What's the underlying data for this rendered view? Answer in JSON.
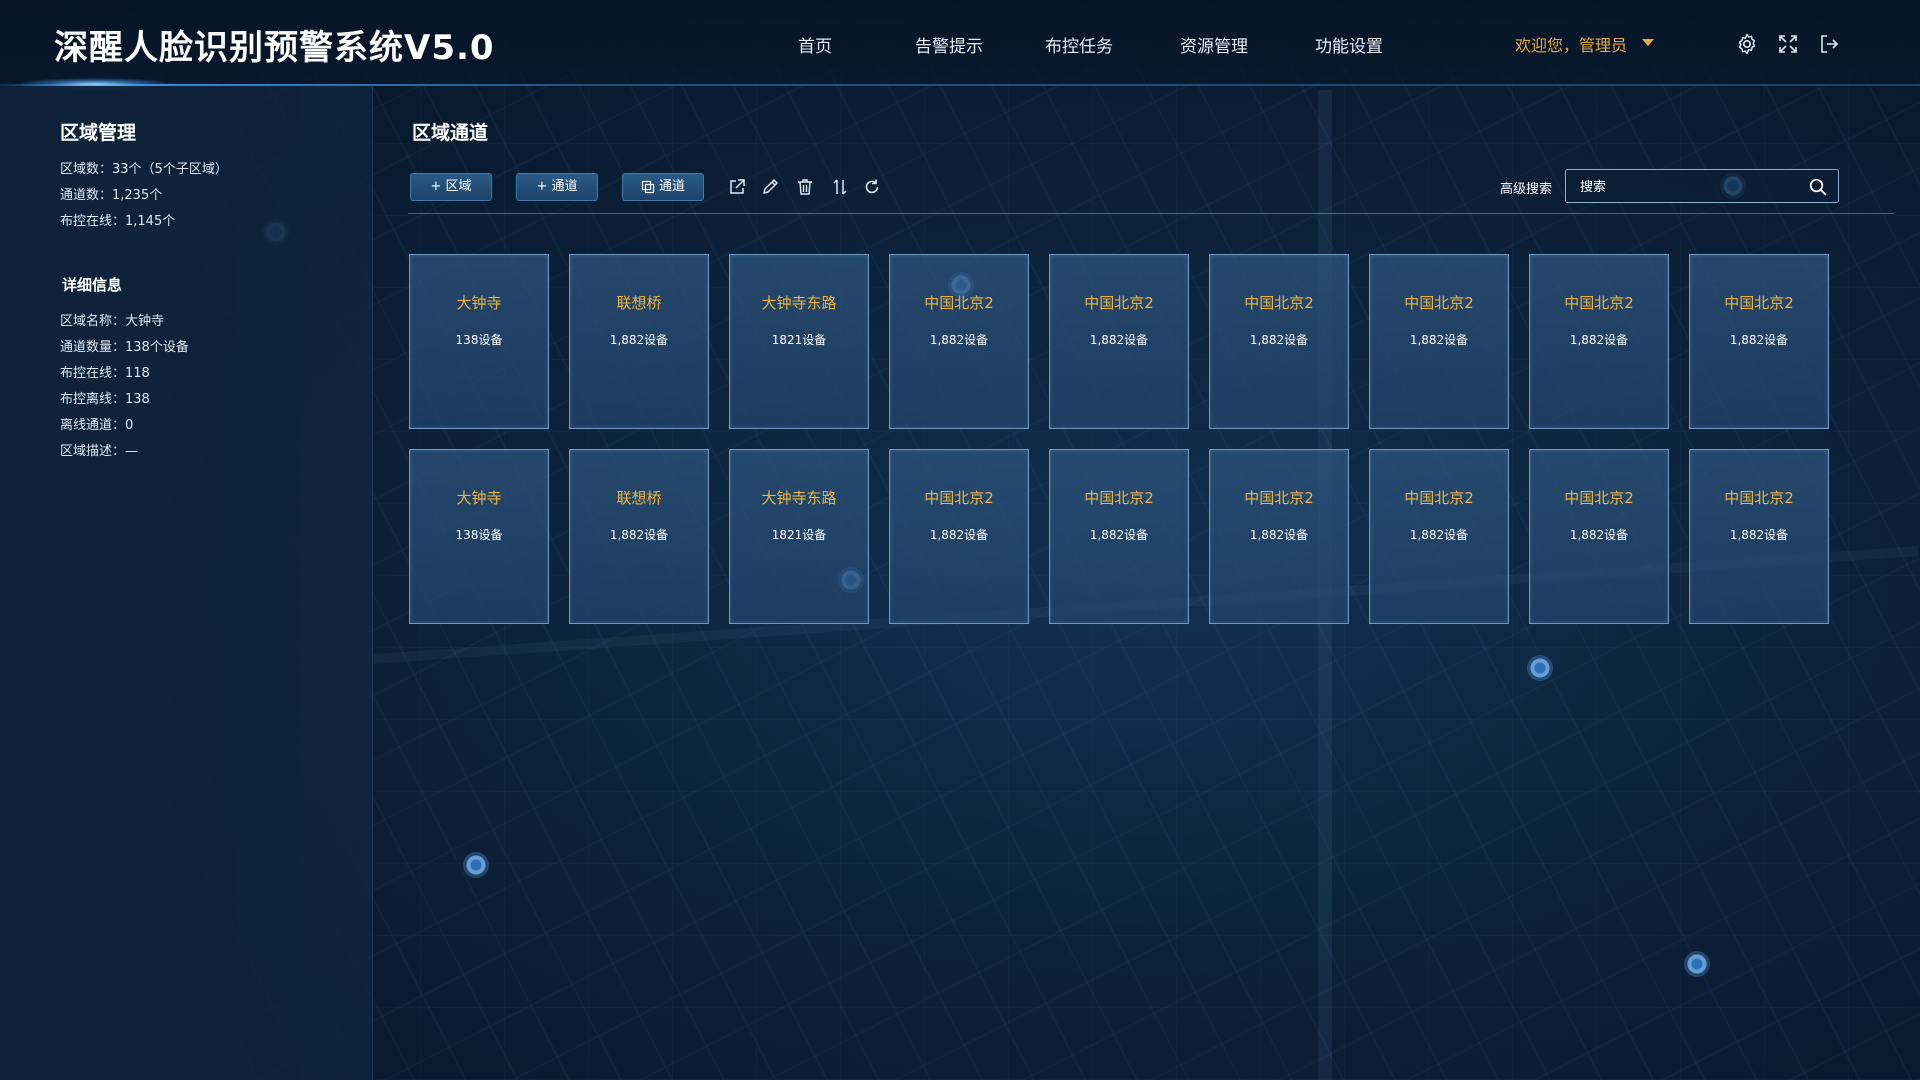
{
  "header": {
    "title": "深醒人脸识别预警系统V5.0",
    "nav": [
      "首页",
      "告警提示",
      "布控任务",
      "资源管理",
      "功能设置"
    ],
    "welcome": "欢迎您，管理员",
    "icons": [
      "gear-icon",
      "fullscreen-icon",
      "logout-icon"
    ]
  },
  "sidebar": {
    "title": "区域管理",
    "stats": [
      "区域数：33个（5个子区域）",
      "通道数：1,235个",
      "布控在线：1,145个"
    ],
    "detail_title": "详细信息",
    "details": [
      "区域名称：大钟寺",
      "通道数量：138个设备",
      "布控在线：118",
      "布控离线：138",
      "离线通道：0",
      "区域描述：—"
    ]
  },
  "main": {
    "title": "区域通道",
    "toolbar": {
      "add_region": "+ 区域",
      "add_channel": "+ 通道",
      "copy_channel": "通道",
      "icons": [
        "export-icon",
        "edit-icon",
        "delete-icon",
        "sort-icon",
        "refresh-icon"
      ]
    },
    "search": {
      "label": "高级搜索",
      "placeholder": "搜索"
    },
    "cards": [
      {
        "name": "大钟寺",
        "count": "138设备"
      },
      {
        "name": "联想桥",
        "count": "1,882设备"
      },
      {
        "name": "大钟寺东路",
        "count": "1821设备"
      },
      {
        "name": "中国北京2",
        "count": "1,882设备"
      },
      {
        "name": "中国北京2",
        "count": "1,882设备"
      },
      {
        "name": "中国北京2",
        "count": "1,882设备"
      },
      {
        "name": "中国北京2",
        "count": "1,882设备"
      },
      {
        "name": "中国北京2",
        "count": "1,882设备"
      },
      {
        "name": "中国北京2",
        "count": "1,882设备"
      },
      {
        "name": "大钟寺",
        "count": "138设备"
      },
      {
        "name": "联想桥",
        "count": "1,882设备"
      },
      {
        "name": "大钟寺东路",
        "count": "1821设备"
      },
      {
        "name": "中国北京2",
        "count": "1,882设备"
      },
      {
        "name": "中国北京2",
        "count": "1,882设备"
      },
      {
        "name": "中国北京2",
        "count": "1,882设备"
      },
      {
        "name": "中国北京2",
        "count": "1,882设备"
      },
      {
        "name": "中国北京2",
        "count": "1,882设备"
      },
      {
        "name": "中国北京2",
        "count": "1,882设备"
      }
    ]
  },
  "colors": {
    "accent": "#e8a93a",
    "card_title": "#f0b43c",
    "line": "#3b8fe0"
  }
}
